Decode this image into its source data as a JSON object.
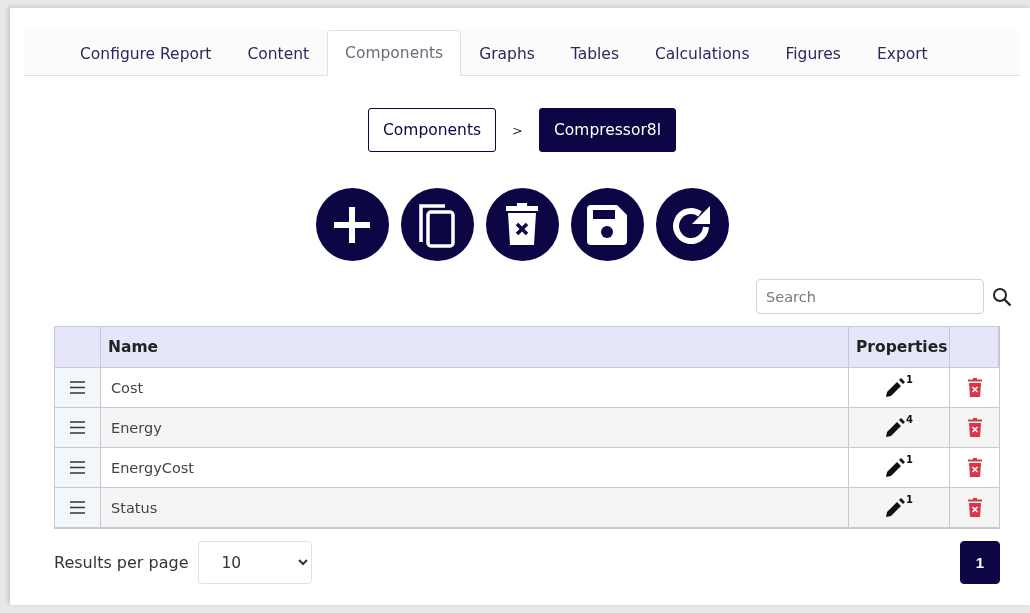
{
  "tabs": [
    {
      "label": "Configure Report",
      "selected": false
    },
    {
      "label": "Content",
      "selected": false
    },
    {
      "label": "Components",
      "selected": true
    },
    {
      "label": "Graphs",
      "selected": false
    },
    {
      "label": "Tables",
      "selected": false
    },
    {
      "label": "Calculations",
      "selected": false
    },
    {
      "label": "Figures",
      "selected": false
    },
    {
      "label": "Export",
      "selected": false
    }
  ],
  "breadcrumb": [
    {
      "label": "Components",
      "selected": false
    },
    {
      "label": "Compressor8l",
      "selected": true
    }
  ],
  "breadcrumb_separator": ">",
  "actions": [
    {
      "kind": "add"
    },
    {
      "kind": "copy"
    },
    {
      "kind": "delete"
    },
    {
      "kind": "save"
    },
    {
      "kind": "refresh"
    }
  ],
  "search": {
    "placeholder": "Search"
  },
  "table": {
    "columns": [
      "Name",
      "Properties"
    ],
    "rows": [
      {
        "name": "Cost",
        "properties": "1"
      },
      {
        "name": "Energy",
        "properties": "4"
      },
      {
        "name": "EnergyCost",
        "properties": "1"
      },
      {
        "name": "Status",
        "properties": "1"
      }
    ]
  },
  "footer": {
    "label": "Results per page",
    "page_size": "10",
    "pages": [
      {
        "label": "1",
        "selected": true
      }
    ]
  }
}
